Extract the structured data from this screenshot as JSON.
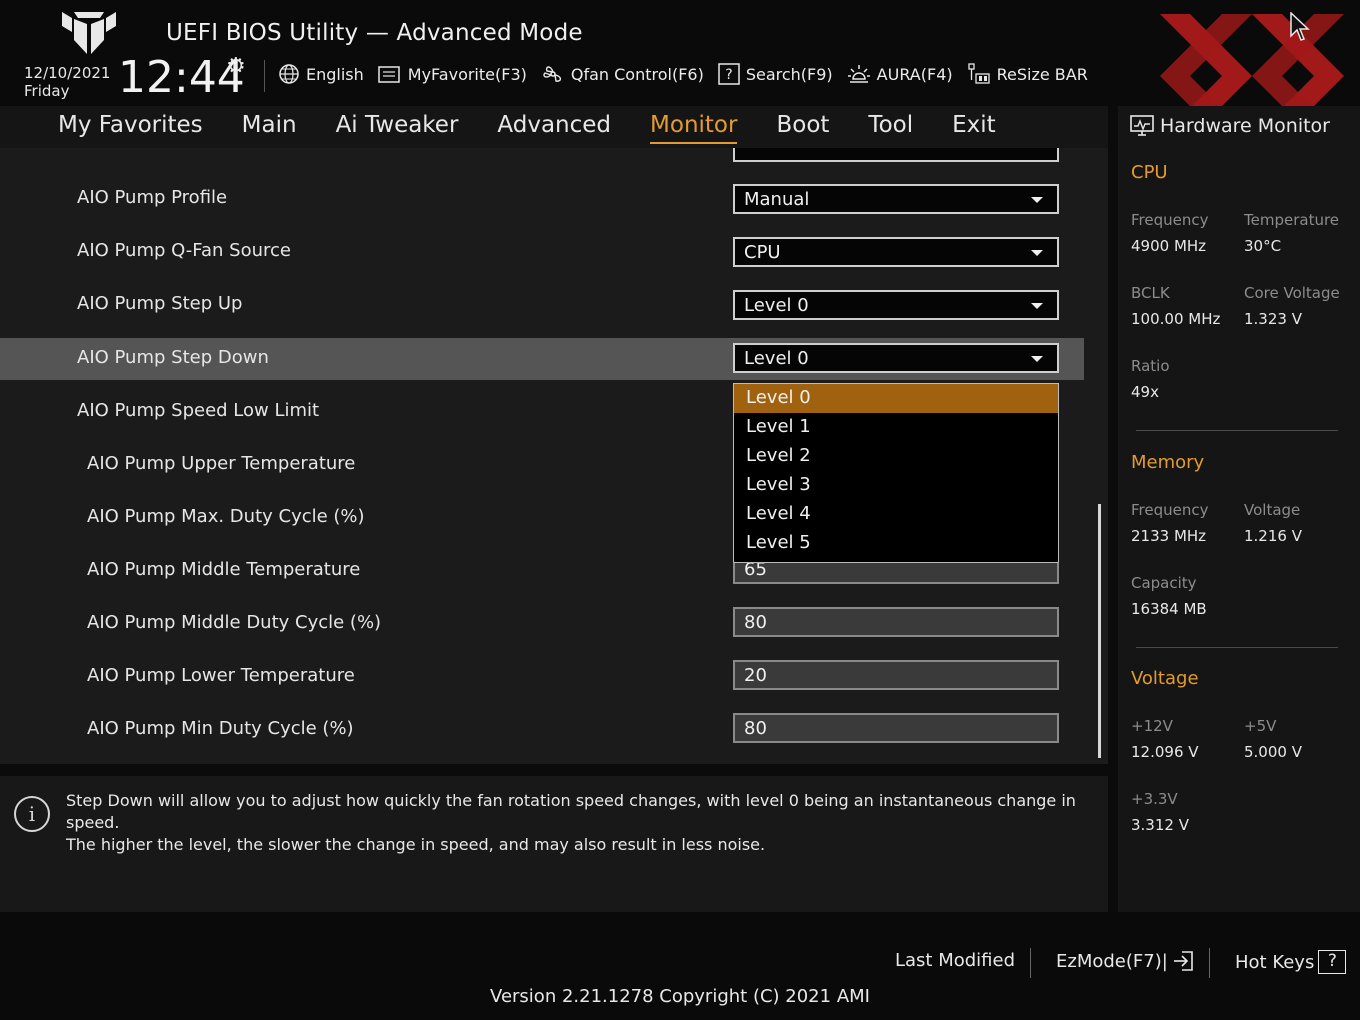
{
  "header": {
    "title": "UEFI BIOS Utility — Advanced Mode",
    "date": "12/10/2021",
    "day": "Friday",
    "time": "12:44",
    "toolbar": [
      {
        "label": "English",
        "icon": "globe-icon"
      },
      {
        "label": "MyFavorite(F3)",
        "icon": "favorite-list-icon"
      },
      {
        "label": "Qfan Control(F6)",
        "icon": "fan-icon"
      },
      {
        "label": "Search(F9)",
        "icon": "search-help-icon"
      },
      {
        "label": "AURA(F4)",
        "icon": "aura-light-icon"
      },
      {
        "label": "ReSize BAR",
        "icon": "resize-bar-icon"
      }
    ]
  },
  "nav": {
    "tabs": [
      "My Favorites",
      "Main",
      "Ai Tweaker",
      "Advanced",
      "Monitor",
      "Boot",
      "Tool",
      "Exit"
    ],
    "active": "Monitor"
  },
  "settings": [
    {
      "label": "AIO Pump Profile",
      "type": "select",
      "value": "Manual"
    },
    {
      "label": "AIO Pump Q-Fan Source",
      "type": "select",
      "value": "CPU"
    },
    {
      "label": "AIO Pump Step Up",
      "type": "select",
      "value": "Level 0"
    },
    {
      "label": "AIO Pump Step Down",
      "type": "select",
      "value": "Level 0"
    },
    {
      "label": "AIO Pump Speed Low Limit",
      "type": "select",
      "value": ""
    },
    {
      "label": "AIO Pump Upper Temperature",
      "type": "number",
      "value": ""
    },
    {
      "label": "AIO Pump Max. Duty Cycle (%)",
      "type": "number",
      "value": ""
    },
    {
      "label": "AIO Pump Middle Temperature",
      "type": "number",
      "value": "65"
    },
    {
      "label": "AIO Pump Middle Duty Cycle (%)",
      "type": "number",
      "value": "80"
    },
    {
      "label": "AIO Pump Lower Temperature",
      "type": "number",
      "value": "20"
    },
    {
      "label": "AIO Pump Min Duty Cycle (%)",
      "type": "number",
      "value": "80"
    }
  ],
  "dropdown": {
    "options": [
      "Level 0",
      "Level 1",
      "Level 2",
      "Level 3",
      "Level 4",
      "Level 5"
    ],
    "selected": "Level 0"
  },
  "help": {
    "line1": "Step Down will allow you to adjust how quickly the fan rotation speed changes, with level 0 being an instantaneous change in speed.",
    "line2": "The higher the level, the slower the change in speed, and may also result in less noise."
  },
  "hardware_monitor": {
    "title": "Hardware Monitor",
    "cpu": {
      "heading": "CPU",
      "frequency_label": "Frequency",
      "frequency": "4900 MHz",
      "temperature_label": "Temperature",
      "temperature": "30°C",
      "bclk_label": "BCLK",
      "bclk": "100.00 MHz",
      "core_voltage_label": "Core Voltage",
      "core_voltage": "1.323 V",
      "ratio_label": "Ratio",
      "ratio": "49x"
    },
    "memory": {
      "heading": "Memory",
      "frequency_label": "Frequency",
      "frequency": "2133 MHz",
      "voltage_label": "Voltage",
      "voltage": "1.216 V",
      "capacity_label": "Capacity",
      "capacity": "16384 MB"
    },
    "voltage": {
      "heading": "Voltage",
      "v12_label": "+12V",
      "v12": "12.096 V",
      "v5_label": "+5V",
      "v5": "5.000 V",
      "v33_label": "+3.3V",
      "v33": "3.312 V"
    }
  },
  "footer": {
    "last_modified": "Last Modified",
    "ezmode": "EzMode(F7)|",
    "hotkeys": "Hot Keys",
    "hotkeys_glyph": "?",
    "version": "Version 2.21.1278 Copyright (C) 2021 AMI"
  },
  "colors": {
    "accent": "#e39b2f",
    "dropdown_selected": "#a0620f",
    "row_highlight": "#555555",
    "watermark": "#b81c1c"
  }
}
